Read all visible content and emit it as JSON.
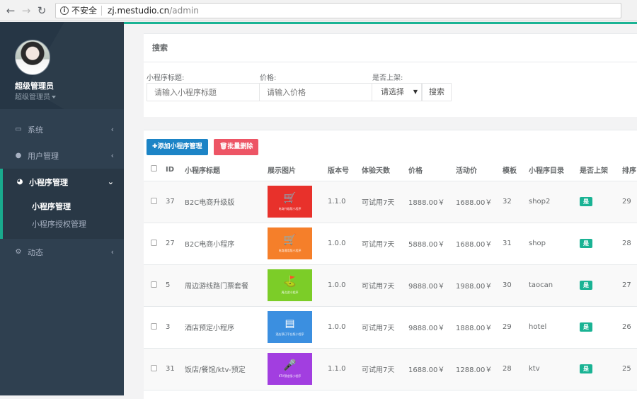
{
  "browser": {
    "security_label": "不安全",
    "url_host": "zj.mestudio.cn",
    "url_path": "/admin"
  },
  "sidebar": {
    "user_name": "超级管理员",
    "user_role": "超级管理员",
    "menu": [
      {
        "label": "系统",
        "icon": "monitor-icon"
      },
      {
        "label": "用户管理",
        "icon": "user-icon"
      },
      {
        "label": "小程序管理",
        "icon": "wechat-icon",
        "active": true
      },
      {
        "label": "动态",
        "icon": "gears-icon"
      }
    ],
    "submenu": [
      "小程序管理",
      "小程序授权管理"
    ]
  },
  "search": {
    "title": "搜索",
    "title_label": "小程序标题:",
    "title_placeholder": "请输入小程序标题",
    "price_label": "价格:",
    "price_placeholder": "请输入价格",
    "onsale_label": "是否上架:",
    "onsale_value": "请选择",
    "search_button": "搜索"
  },
  "toolbar": {
    "add_button": "✚添加小程序管理",
    "batch_delete_button": "🗑批量删除"
  },
  "table": {
    "headers": [
      "ID",
      "小程序标题",
      "展示图片",
      "版本号",
      "体验天数",
      "价格",
      "活动价",
      "模板",
      "小程序目录",
      "是否上架",
      "排序"
    ],
    "rows": [
      {
        "id": "37",
        "title": "B2C电商升级版",
        "thumb_color": "#e8312b",
        "thumb_icon": "cart-icon",
        "thumb_caption": "电商升级版小程序",
        "version": "1.1.0",
        "trial": "可试用7天",
        "price": "1888.00￥",
        "promo": "1688.00￥",
        "template": "32",
        "dir": "shop2",
        "onsale": "是",
        "sort": "29"
      },
      {
        "id": "27",
        "title": "B2C电商小程序",
        "thumb_color": "#f57f2a",
        "thumb_icon": "cart-icon",
        "thumb_caption": "电商通用版小程序",
        "version": "1.0.0",
        "trial": "可试用7天",
        "price": "5888.00￥",
        "promo": "1688.00￥",
        "template": "31",
        "dir": "shop",
        "onsale": "是",
        "sort": "28"
      },
      {
        "id": "5",
        "title": "周边游线路门票套餐",
        "thumb_color": "#7ccd28",
        "thumb_icon": "signpost-icon",
        "thumb_caption": "周边游小程序",
        "version": "1.0.0",
        "trial": "可试用7天",
        "price": "9888.00￥",
        "promo": "1988.00￥",
        "template": "30",
        "dir": "taocan",
        "onsale": "是",
        "sort": "27"
      },
      {
        "id": "3",
        "title": "酒店预定小程序",
        "thumb_color": "#3b8fe0",
        "thumb_icon": "building-icon",
        "thumb_caption": "酒店预订平台版小程序",
        "version": "1.0.0",
        "trial": "可试用7天",
        "price": "9888.00￥",
        "promo": "1888.00￥",
        "template": "29",
        "dir": "hotel",
        "onsale": "是",
        "sort": "26"
      },
      {
        "id": "31",
        "title": "饭店/餐馆/ktv-预定",
        "thumb_color": "#a23ee0",
        "thumb_icon": "microphone-icon",
        "thumb_caption": "KTV预定版小程序",
        "version": "1.1.0",
        "trial": "可试用7天",
        "price": "1688.00￥",
        "promo": "1288.00￥",
        "template": "28",
        "dir": "ktv",
        "onsale": "是",
        "sort": "25"
      }
    ]
  }
}
